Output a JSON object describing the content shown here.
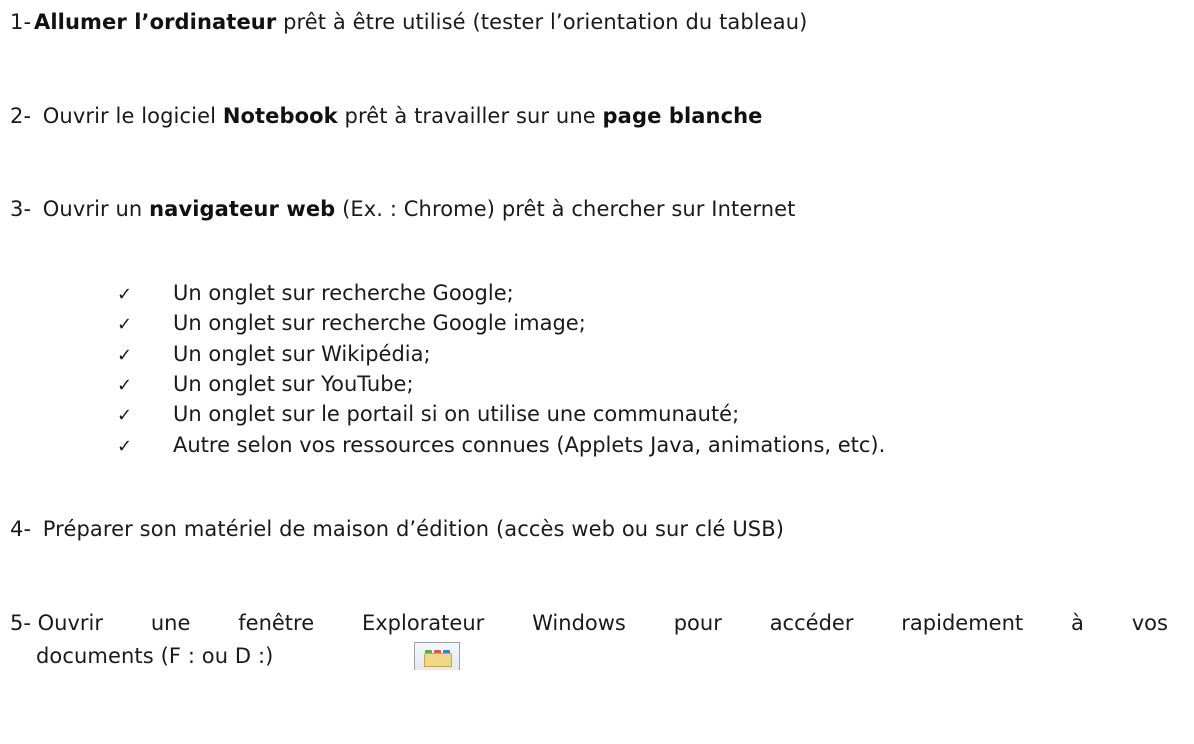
{
  "steps": [
    {
      "number": "1-",
      "bold": "Allumer l’ordinateur",
      "rest": " prêt à être utilisé (tester l’orientation du tableau)"
    },
    {
      "number": "2-",
      "pre": " Ouvrir le logiciel ",
      "bold1": "Notebook",
      "mid": " prêt à travailler sur une ",
      "bold2": "page blanche"
    },
    {
      "number": "3-",
      "pre": " Ouvrir un ",
      "bold": "navigateur web",
      "rest": " (Ex. : Chrome) prêt à chercher sur Internet"
    },
    {
      "number": "4-",
      "text": " Préparer son matériel de maison d’édition (accès web ou sur clé USB)"
    },
    {
      "number": "5-",
      "line1_words": [
        "Ouvrir",
        "une",
        "fenêtre",
        "Explorateur",
        "Windows",
        "pour",
        "accéder",
        "rapidement",
        "à",
        "vos"
      ],
      "line2": "documents (F : ou D :)"
    }
  ],
  "checklist": [
    "Un onglet sur recherche Google;",
    "Un onglet sur recherche Google image;",
    "Un onglet sur Wikipédia;",
    "Un onglet sur YouTube;",
    "Un onglet sur le portail si on utilise une communauté;",
    "Autre selon vos ressources connues (Applets Java, animations, etc)."
  ],
  "icons": {
    "checkmark": "check-icon",
    "explorer": "windows-explorer-icon"
  }
}
